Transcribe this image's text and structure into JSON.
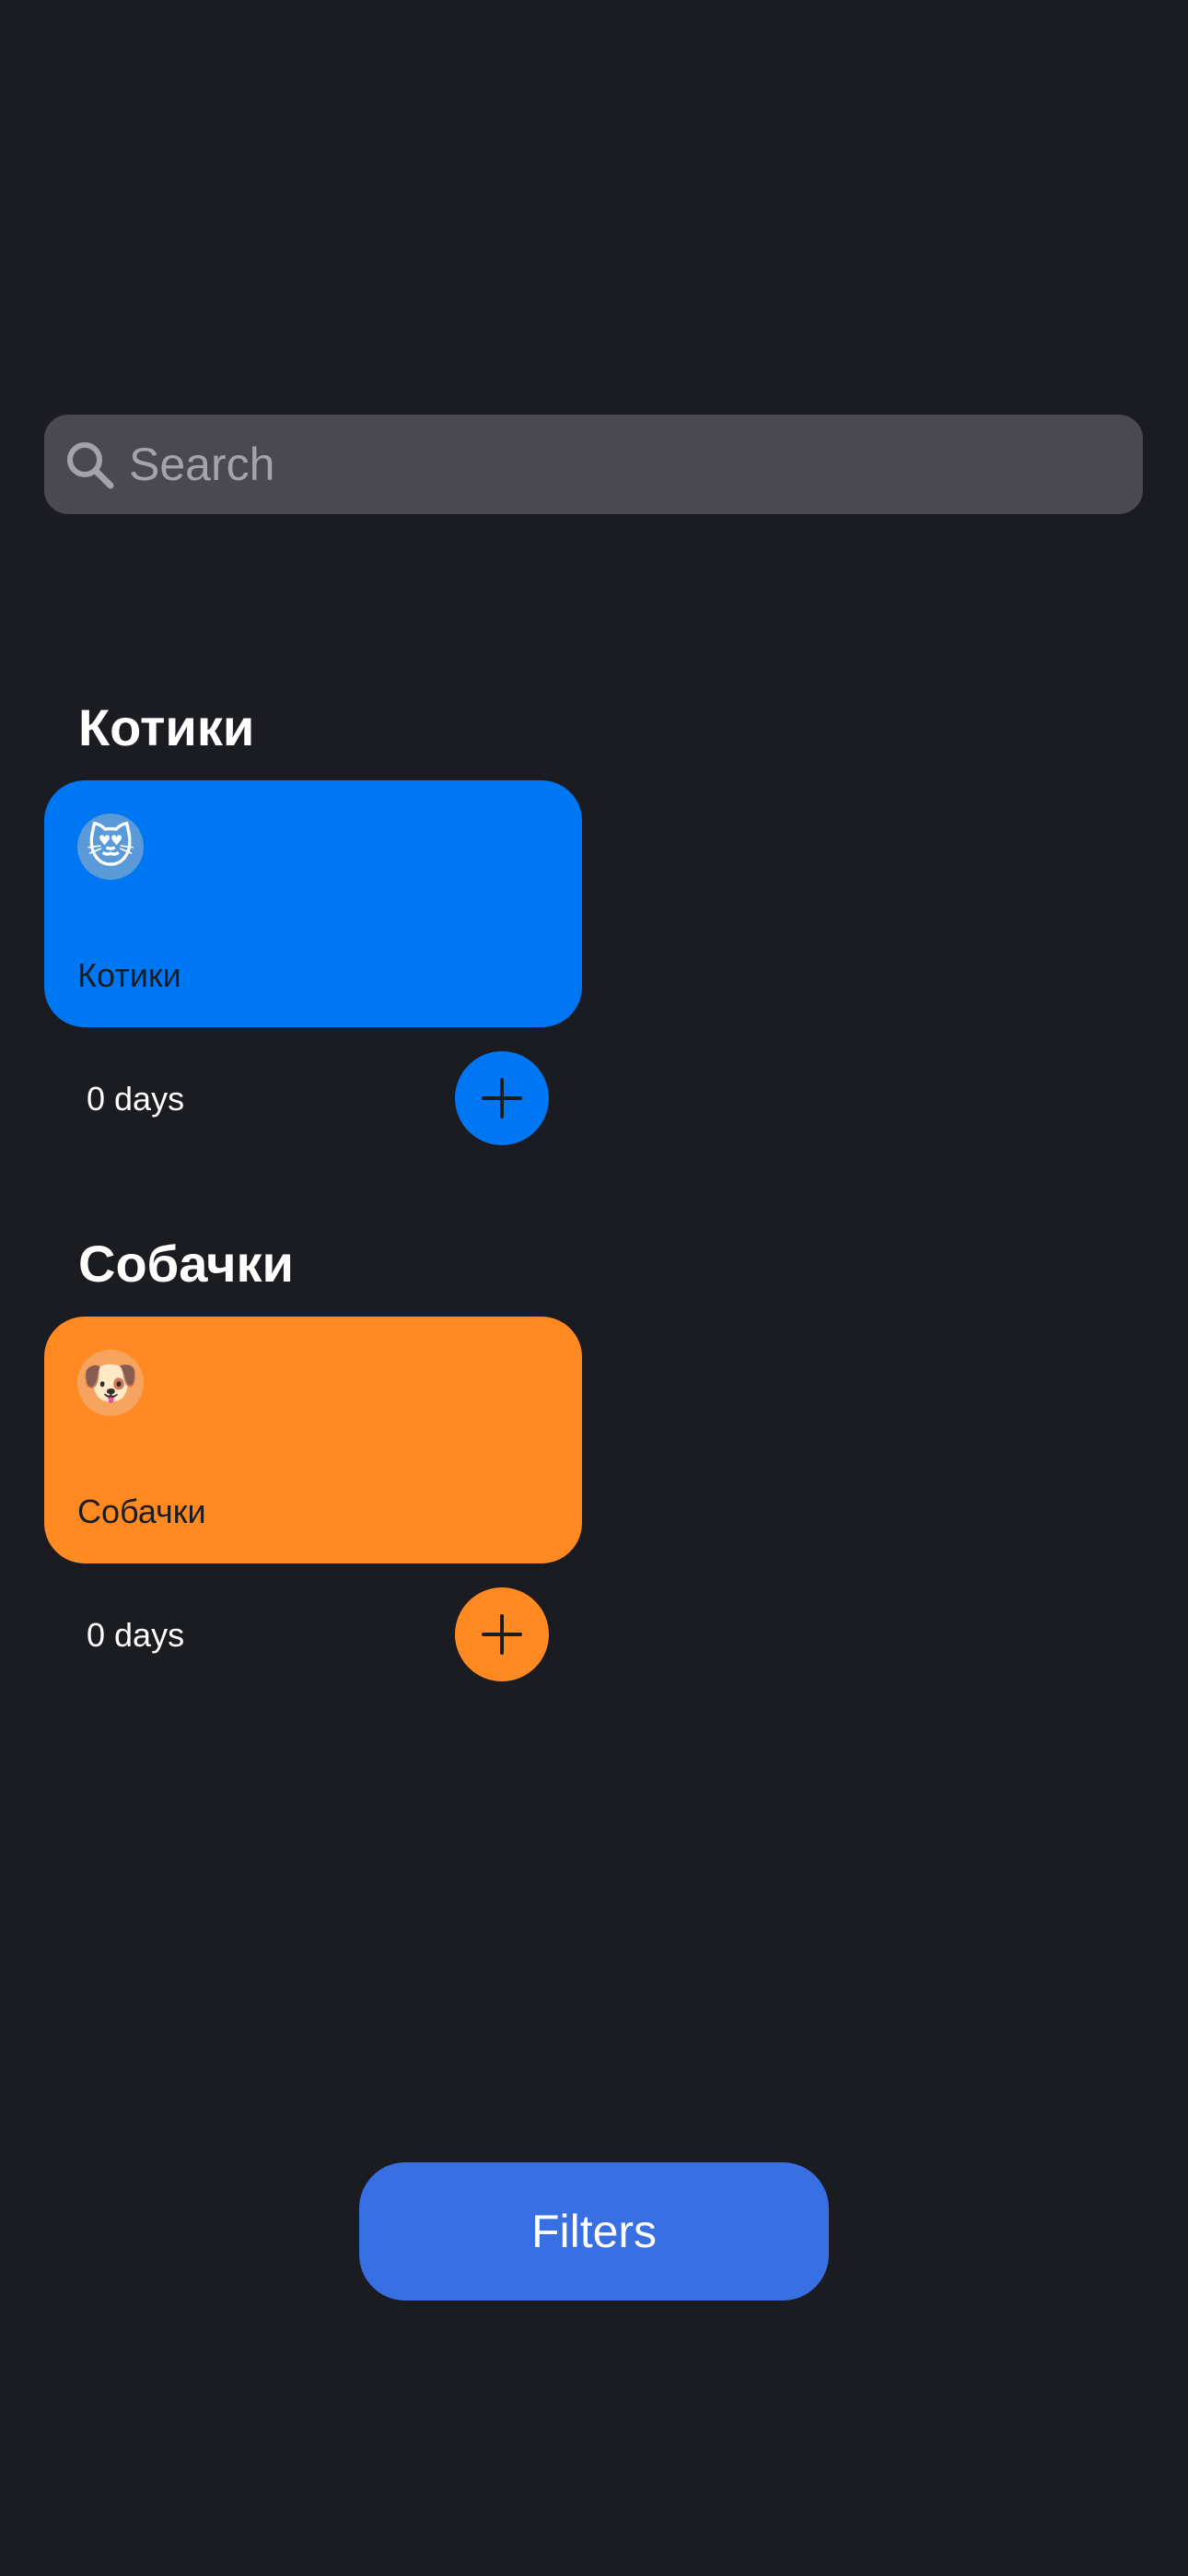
{
  "search": {
    "placeholder": "Search",
    "icon": "search-icon"
  },
  "groups": [
    {
      "title": "Котики",
      "card_label": "Котики",
      "emoji": "😻",
      "days": "0 days",
      "color": "#0077f2",
      "badge_color": "#5a9ad8",
      "add_icon": "plus-icon"
    },
    {
      "title": "Собачки",
      "card_label": "Собачки",
      "emoji": "🐶",
      "days": "0 days",
      "color": "#ff8a22",
      "badge_color": "#f5a35e",
      "add_icon": "plus-icon"
    }
  ],
  "filters_button": {
    "label": "Filters",
    "color": "#3870e3"
  },
  "colors": {
    "background": "#1b1b22",
    "search_bar": "#4a494f"
  }
}
